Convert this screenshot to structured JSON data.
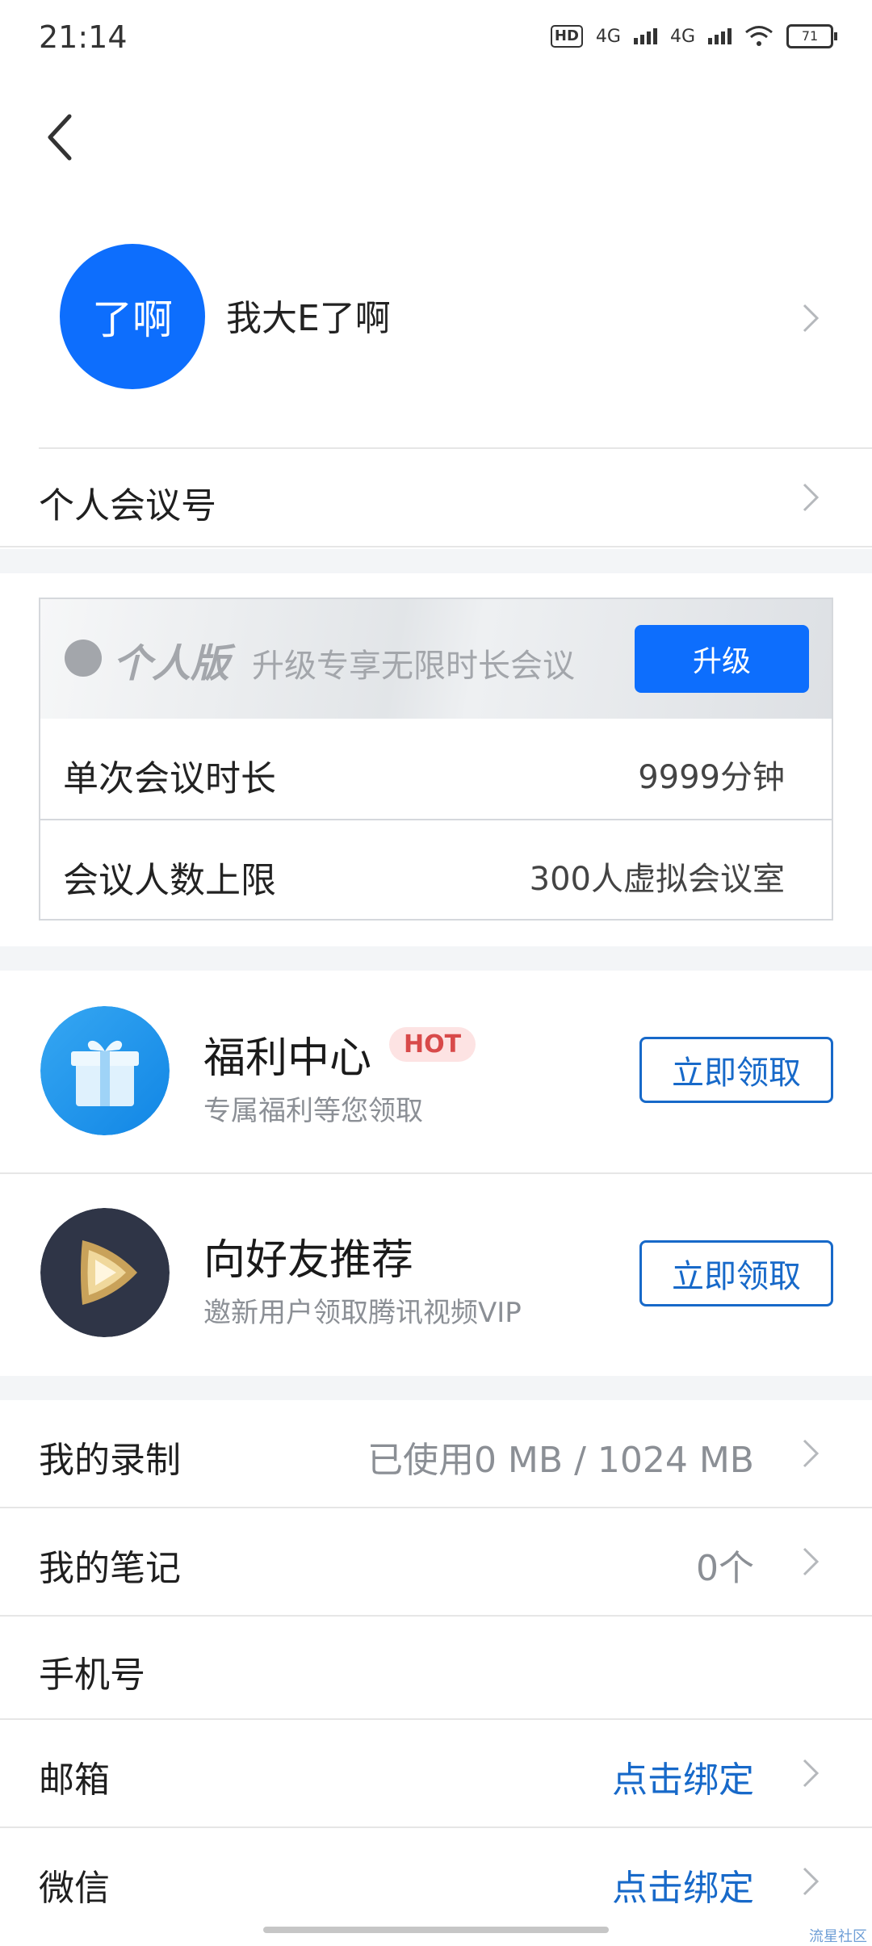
{
  "status_bar": {
    "time": "21:14",
    "hd": "HD",
    "net1": "4G",
    "net2": "4G",
    "battery": "71"
  },
  "profile": {
    "avatar_text": "了啊",
    "nickname": "我大E了啊"
  },
  "personal_meeting": {
    "label": "个人会议号"
  },
  "plan": {
    "title": "个人版",
    "subtitle": "升级专享无限时长会议",
    "upgrade_label": "升级",
    "rows": [
      {
        "label": "单次会议时长",
        "value": "9999分钟"
      },
      {
        "label": "会议人数上限",
        "value": "300人虚拟会议室"
      }
    ]
  },
  "promos": [
    {
      "title": "福利中心",
      "badge": "HOT",
      "subtitle": "专属福利等您领取",
      "button": "立即领取",
      "icon": "gift-icon"
    },
    {
      "title": "向好友推荐",
      "subtitle": "邀新用户领取腾讯视频VIP",
      "button": "立即领取",
      "icon": "video-play-icon"
    }
  ],
  "list": [
    {
      "label": "我的录制",
      "value": "已使用0 MB / 1024 MB"
    },
    {
      "label": "我的笔记",
      "value": "0个"
    },
    {
      "label": "手机号",
      "value": ""
    },
    {
      "label": "邮箱",
      "value": "点击绑定"
    },
    {
      "label": "微信",
      "value": "点击绑定"
    }
  ],
  "watermark": "流星社区",
  "colors": {
    "accent": "#0d6efd",
    "link": "#1769c9",
    "hot": "#d84a4a"
  }
}
